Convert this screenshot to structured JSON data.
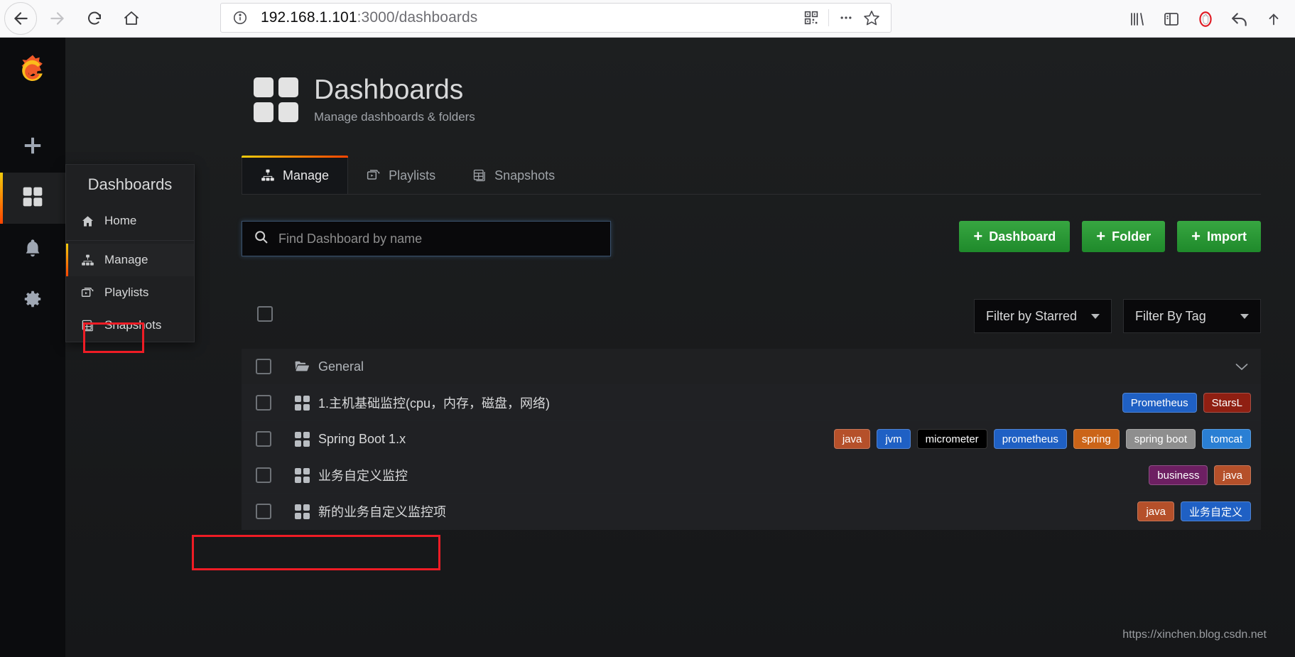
{
  "browser": {
    "back_icon": "back-arrow-icon",
    "forward_icon": "forward-arrow-icon",
    "reload_icon": "reload-icon",
    "home_icon": "home-icon",
    "url_host": "192.168.1.101",
    "url_path": ":3000/dashboards",
    "info_icon": "page-info-icon",
    "qr_icon": "qr-code-icon",
    "more_icon": "more-actions-icon",
    "bookmark_icon": "star-bookmark-icon",
    "library_icon": "library-icon",
    "sidebar_icon": "sidebar-toggle-icon",
    "shield_icon": "tracking-protection-icon",
    "undo_icon": "undo-icon"
  },
  "sidemenu": {
    "logo": "grafana-logo",
    "items": [
      {
        "name": "create-add",
        "icon": "plus-icon"
      },
      {
        "name": "dashboards",
        "icon": "dashboards-grid-icon",
        "active": true
      },
      {
        "name": "alerting",
        "icon": "bell-icon"
      },
      {
        "name": "configuration",
        "icon": "gear-icon"
      }
    ]
  },
  "dropdown": {
    "header": "Dashboards",
    "items": [
      {
        "label": "Home",
        "icon": "home-icon",
        "selected": false
      },
      {
        "label": "Manage",
        "icon": "sitemap-icon",
        "selected": true
      },
      {
        "label": "Playlists",
        "icon": "playlist-icon",
        "selected": false
      },
      {
        "label": "Snapshots",
        "icon": "snapshot-icon",
        "selected": false
      }
    ]
  },
  "page": {
    "title": "Dashboards",
    "subtitle": "Manage dashboards & folders"
  },
  "tabs": [
    {
      "label": "Manage",
      "icon": "sitemap-icon",
      "active": true
    },
    {
      "label": "Playlists",
      "icon": "playlist-icon",
      "active": false
    },
    {
      "label": "Snapshots",
      "icon": "snapshot-icon",
      "active": false
    }
  ],
  "search": {
    "placeholder": "Find Dashboard by name",
    "value": "",
    "icon": "search-icon"
  },
  "actions": [
    {
      "label": "Dashboard",
      "name": "new-dashboard-button",
      "color": "#2d9c3c"
    },
    {
      "label": "Folder",
      "name": "new-folder-button",
      "color": "#2d9c3c"
    },
    {
      "label": "Import",
      "name": "import-dashboard-button",
      "color": "#2d9c3c"
    }
  ],
  "filters": [
    {
      "label": "Filter by Starred",
      "name": "filter-by-starred-select"
    },
    {
      "label": "Filter By Tag",
      "name": "filter-by-tag-select"
    }
  ],
  "list": {
    "folder": {
      "label": "General",
      "icon": "folder-open-icon",
      "collapse_icon": "chevron-down-icon"
    },
    "rows": [
      {
        "title": "1.主机基础监控(cpu，内存，磁盘，网络)",
        "tags": [
          {
            "label": "Prometheus",
            "color": "#1f60c4"
          },
          {
            "label": "StarsL",
            "color": "#8f1f12"
          }
        ]
      },
      {
        "title": "Spring Boot 1.x",
        "tags": [
          {
            "label": "java",
            "color": "#b5502a"
          },
          {
            "label": "jvm",
            "color": "#1f60c4"
          },
          {
            "label": "micrometer",
            "color": "#000000"
          },
          {
            "label": "prometheus",
            "color": "#1f60c4"
          },
          {
            "label": "spring",
            "color": "#cb6418"
          },
          {
            "label": "spring boot",
            "color": "#8e8e8e"
          },
          {
            "label": "tomcat",
            "color": "#2a7fd4"
          }
        ]
      },
      {
        "title": "业务自定义监控",
        "tags": [
          {
            "label": "business",
            "color": "#6d1f62"
          },
          {
            "label": "java",
            "color": "#b5502a"
          }
        ]
      },
      {
        "title": "新的业务自定义监控项",
        "tags": [
          {
            "label": "java",
            "color": "#b5502a"
          },
          {
            "label": "业务自定义",
            "color": "#1f60c4"
          }
        ]
      }
    ]
  },
  "watermark": "https://xinchen.blog.csdn.net",
  "annotation_color": "#ee1c25"
}
